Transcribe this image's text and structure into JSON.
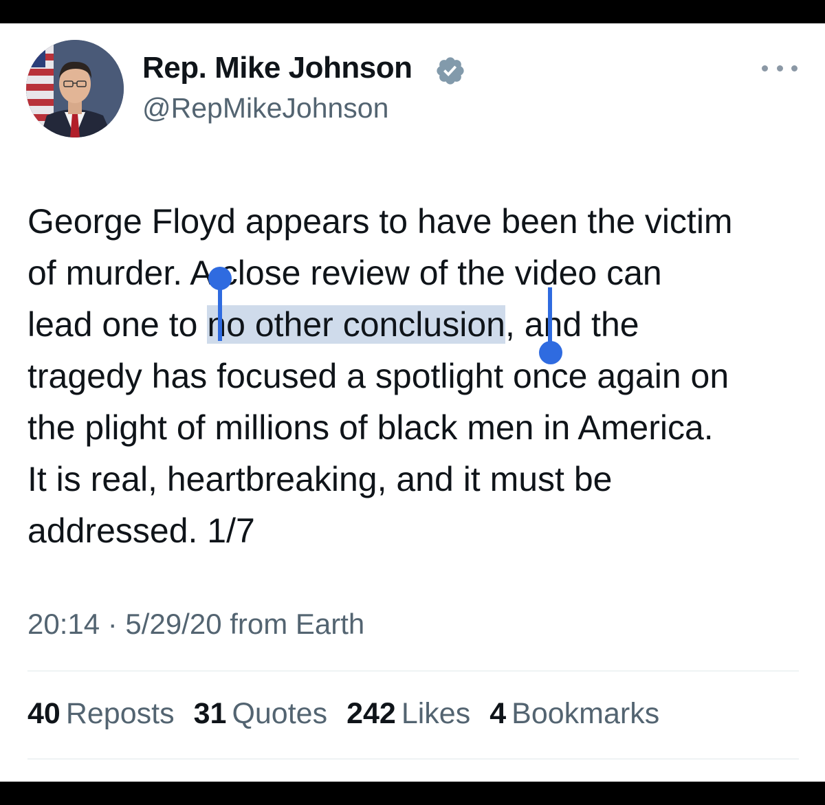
{
  "author": {
    "display_name": "Rep. Mike Johnson",
    "handle": "@RepMikeJohnson"
  },
  "tweet": {
    "lines": [
      {
        "pre": "George Floyd appears to have been the victim",
        "sel": "",
        "post": ""
      },
      {
        "pre": "of murder. A close review of the video can",
        "sel": "",
        "post": ""
      },
      {
        "pre": "lead one to ",
        "sel": "no other conclusion",
        "post": ", and the"
      },
      {
        "pre": "tragedy has focused a spotlight once again on",
        "sel": "",
        "post": ""
      },
      {
        "pre": "the plight of millions of black men in America.",
        "sel": "",
        "post": ""
      },
      {
        "pre": "It is real, heartbreaking, and it must be",
        "sel": "",
        "post": ""
      },
      {
        "pre": "addressed. 1/7",
        "sel": "",
        "post": ""
      }
    ],
    "selected_text": "no other conclusion",
    "timestamp": "20:14 · 5/29/20 from Earth"
  },
  "stats": [
    {
      "count": "40",
      "label": "Reposts"
    },
    {
      "count": "31",
      "label": "Quotes"
    },
    {
      "count": "242",
      "label": "Likes"
    },
    {
      "count": "4",
      "label": "Bookmarks"
    }
  ],
  "icons": {
    "verified": "verified-badge-icon",
    "more": "more-options-icon"
  },
  "colors": {
    "verified_badge": "#829aab",
    "selection": "#cfdbeb",
    "selection_handle": "#2f6be0",
    "secondary_text": "#536471"
  }
}
